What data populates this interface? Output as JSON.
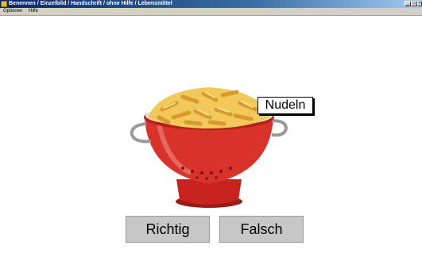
{
  "window": {
    "title": "Benennen / Einzelbild / Handschrift / ohne Hilfe / Lebensmittel",
    "controls": [
      "_",
      "□",
      "×"
    ]
  },
  "menu": {
    "items": [
      "Optionen",
      "Hilfe"
    ]
  },
  "exercise": {
    "picture_subject": "pasta-colander",
    "answer_label": "Nudeln",
    "buttons": {
      "correct": "Richtig",
      "wrong": "Falsch"
    }
  },
  "colors": {
    "colander_red": "#d8322a",
    "pasta_yellow": "#f3c85a",
    "button_gray": "#c7c7c7"
  }
}
